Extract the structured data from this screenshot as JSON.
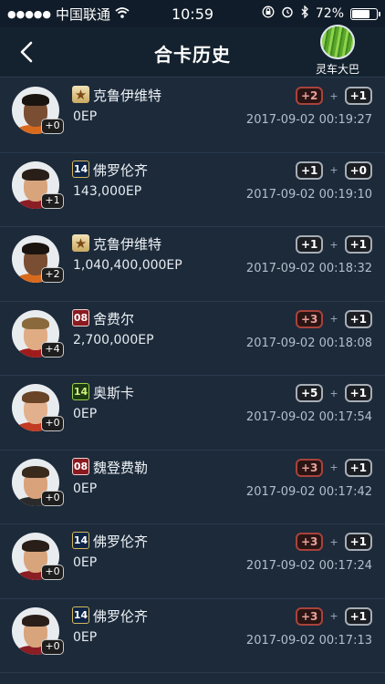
{
  "status_bar": {
    "carrier": "中国联通",
    "time": "10:59",
    "battery": "72%",
    "battery_level": 0.72
  },
  "nav": {
    "title": "合卡历史",
    "user_name": "灵车大巴"
  },
  "records": [
    {
      "badge": "star",
      "name": "克鲁伊维特",
      "ep": "0EP",
      "level": "+0",
      "left": "+2",
      "left_style": "red",
      "right": "+1",
      "right_style": "grey",
      "date": "2017-09-02 00:19:27",
      "skin": "#7a4e32",
      "hair": "#1a1410",
      "shirt": "#d86a1e"
    },
    {
      "badge": "b14",
      "badge_text": "14",
      "name": "佛罗伦齐",
      "ep": "143,000EP",
      "level": "+1",
      "left": "+1",
      "left_style": "grey",
      "right": "+0",
      "right_style": "grey",
      "date": "2017-09-02 00:19:10",
      "skin": "#d8a47c",
      "hair": "#2a1f18",
      "shirt": "#8b1d24"
    },
    {
      "badge": "star",
      "name": "克鲁伊维特",
      "ep": "1,040,400,000EP",
      "level": "+2",
      "left": "+1",
      "left_style": "grey",
      "right": "+1",
      "right_style": "grey",
      "date": "2017-09-02 00:18:32",
      "skin": "#7a4e32",
      "hair": "#1a1410",
      "shirt": "#d86a1e"
    },
    {
      "badge": "b08",
      "badge_text": "08",
      "name": "舍费尔",
      "ep": "2,700,000EP",
      "level": "+4",
      "left": "+3",
      "left_style": "red",
      "right": "+1",
      "right_style": "grey",
      "date": "2017-09-02 00:18:08",
      "skin": "#e0ac84",
      "hair": "#8a6a3c",
      "shirt": "#a01c1c"
    },
    {
      "badge": "b14g",
      "badge_text": "14",
      "name": "奥斯卡",
      "ep": "0EP",
      "level": "+0",
      "left": "+5",
      "left_style": "grey",
      "right": "+1",
      "right_style": "grey",
      "date": "2017-09-02 00:17:54",
      "skin": "#e2b08c",
      "hair": "#6a4426",
      "shirt": "#c23b22"
    },
    {
      "badge": "b08",
      "badge_text": "08",
      "name": "魏登费勒",
      "ep": "0EP",
      "level": "+0",
      "left": "+3",
      "left_style": "red",
      "right": "+1",
      "right_style": "grey",
      "date": "2017-09-02 00:17:42",
      "skin": "#d9a27a",
      "hair": "#3a2a1c",
      "shirt": "#2a2a2a"
    },
    {
      "badge": "b14",
      "badge_text": "14",
      "name": "佛罗伦齐",
      "ep": "0EP",
      "level": "+0",
      "left": "+3",
      "left_style": "red",
      "right": "+1",
      "right_style": "grey",
      "date": "2017-09-02 00:17:24",
      "skin": "#d8a47c",
      "hair": "#2a1f18",
      "shirt": "#8b1d24"
    },
    {
      "badge": "b14",
      "badge_text": "14",
      "name": "佛罗伦齐",
      "ep": "0EP",
      "level": "+0",
      "left": "+3",
      "left_style": "red",
      "right": "+1",
      "right_style": "grey",
      "date": "2017-09-02 00:17:13",
      "skin": "#d8a47c",
      "hair": "#2a1f18",
      "shirt": "#8b1d24"
    }
  ]
}
